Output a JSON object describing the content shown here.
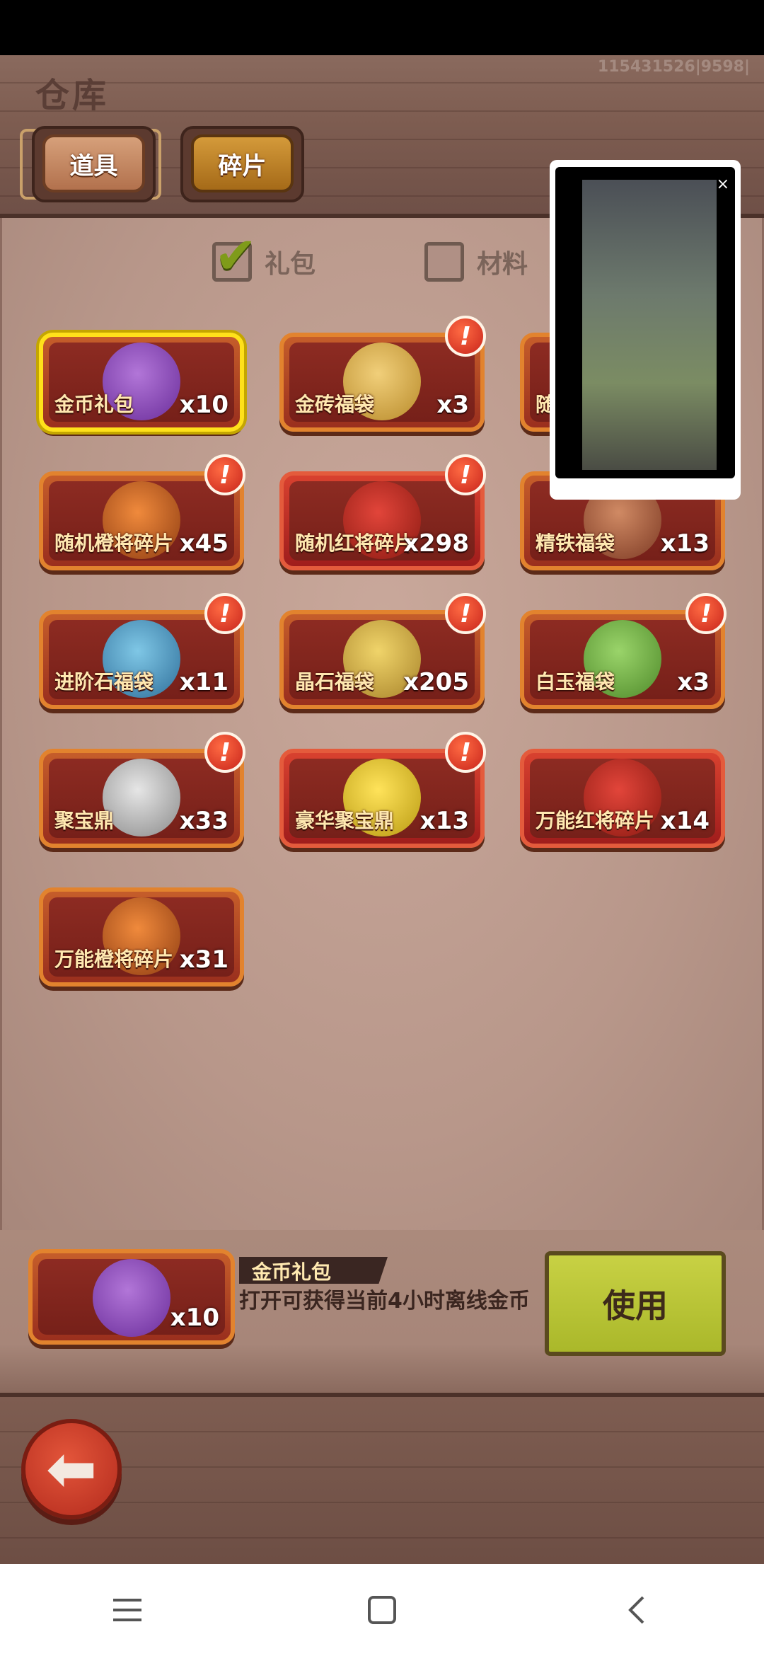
{
  "header": {
    "title": "仓库",
    "user_id": "115431526|9598|"
  },
  "tabs": [
    {
      "label": "道具",
      "active": true
    },
    {
      "label": "碎片",
      "active": false
    }
  ],
  "filters": [
    {
      "label": "礼包",
      "checked": true
    },
    {
      "label": "材料",
      "checked": false
    }
  ],
  "items": [
    {
      "name": "金币礼包",
      "count": "x10",
      "icon": "purple-coin-bag-icon",
      "selected": true,
      "alert": false
    },
    {
      "name": "金砖福袋",
      "count": "x3",
      "icon": "gold-brick-bag-icon",
      "alert": true
    },
    {
      "name": "随",
      "count": "",
      "icon": "purple-bag-icon",
      "alert": false
    },
    {
      "name": "随机橙将碎片",
      "count": "x45",
      "icon": "orange-chest-icon",
      "alert": true
    },
    {
      "name": "随机红将碎片",
      "count": "x298",
      "icon": "red-chest-icon",
      "alert": true,
      "red": true
    },
    {
      "name": "精铁福袋",
      "count": "x13",
      "icon": "iron-bag-icon",
      "alert": false
    },
    {
      "name": "进阶石福袋",
      "count": "x11",
      "icon": "blue-stone-bag-icon",
      "alert": true
    },
    {
      "name": "晶石福袋",
      "count": "x205",
      "icon": "crystal-bag-icon",
      "alert": true
    },
    {
      "name": "白玉福袋",
      "count": "x3",
      "icon": "jade-bag-icon",
      "alert": true
    },
    {
      "name": "聚宝鼎",
      "count": "x33",
      "icon": "silver-cauldron-icon",
      "alert": true
    },
    {
      "name": "豪华聚宝鼎",
      "count": "x13",
      "icon": "gold-cauldron-icon",
      "alert": true,
      "red": true
    },
    {
      "name": "万能红将碎片",
      "count": "x14",
      "icon": "universal-red-chest-icon",
      "alert": false,
      "red": true
    },
    {
      "name": "万能橙将碎片",
      "count": "x31",
      "icon": "universal-orange-chest-icon",
      "alert": false
    }
  ],
  "detail": {
    "name": "金币礼包",
    "count": "x10",
    "description": "打开可获得当前4小时离线金币",
    "use_label": "使用"
  },
  "pip": {
    "close": "×"
  },
  "colors": {
    "alert_red": "#c8241b",
    "use_button": "#aab82a",
    "selected_border": "#ffe11a"
  }
}
